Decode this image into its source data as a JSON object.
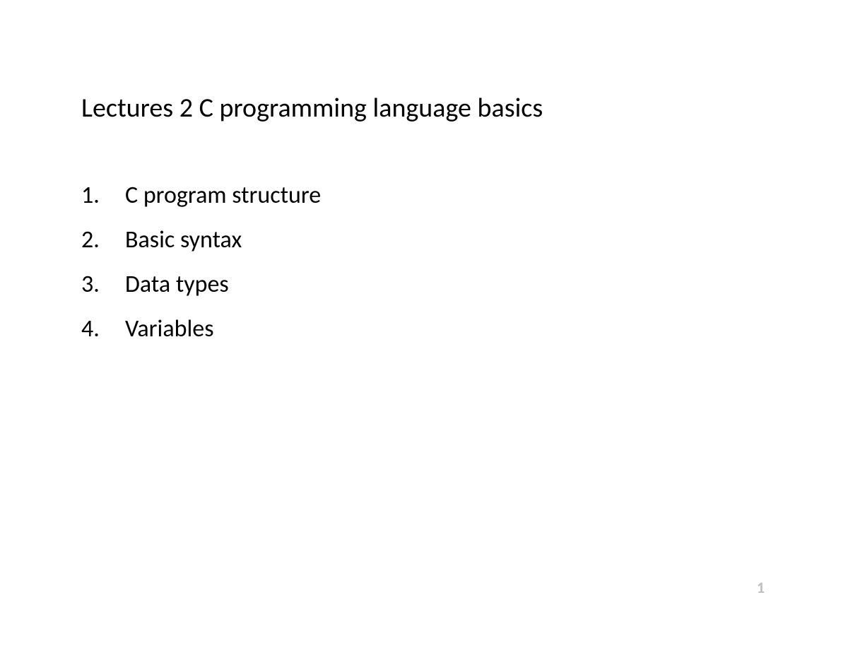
{
  "title": "Lectures 2  C programming language basics",
  "items": [
    {
      "number": "1.",
      "text": "C program structure"
    },
    {
      "number": "2.",
      "text": "Basic syntax"
    },
    {
      "number": "3.",
      "text": "Data types"
    },
    {
      "number": "4.",
      "text": "Variables"
    }
  ],
  "pageNumber": "1"
}
